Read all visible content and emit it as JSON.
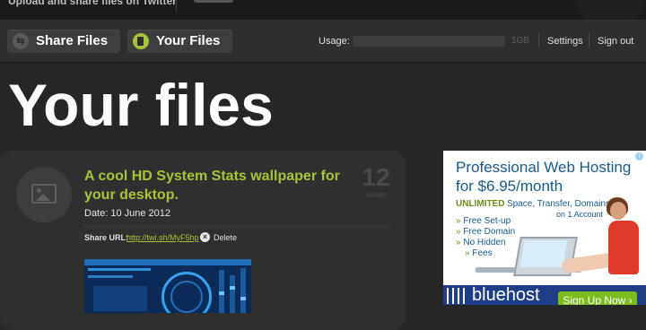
{
  "header": {
    "tagline": "Upload and share files on Twitter"
  },
  "nav": {
    "share_files": "Share Files",
    "your_files": "Your Files",
    "usage_label": "Usage:",
    "usage_total": "1GB",
    "usage_fraction": 0.0,
    "settings": "Settings",
    "sign_out": "Sign out"
  },
  "page": {
    "title": "Your files"
  },
  "file": {
    "title": "A cool HD System Stats wallpaper for your desktop.",
    "date": "Date: 10 June 2012",
    "views_count": "12",
    "views_label": "views",
    "share_label": "Share URL:",
    "share_url": "http://twi.sh/MyF5hp",
    "delete_label": "Delete"
  },
  "ad": {
    "headline1": "Professional Web Hosting",
    "headline2": "for $6.95/month",
    "unlimited": "UNLIMITED",
    "features": "Space, Transfer, Domains",
    "account": "on 1 Account",
    "list": [
      "Free Set-up",
      "Free Domain",
      "No Hidden",
      "Fees"
    ],
    "brand": "bluehost",
    "cta": "Sign Up Now ›"
  },
  "colors": {
    "accent_green": "#a6c43a",
    "background": "#262626",
    "card": "#2f2f2f"
  }
}
